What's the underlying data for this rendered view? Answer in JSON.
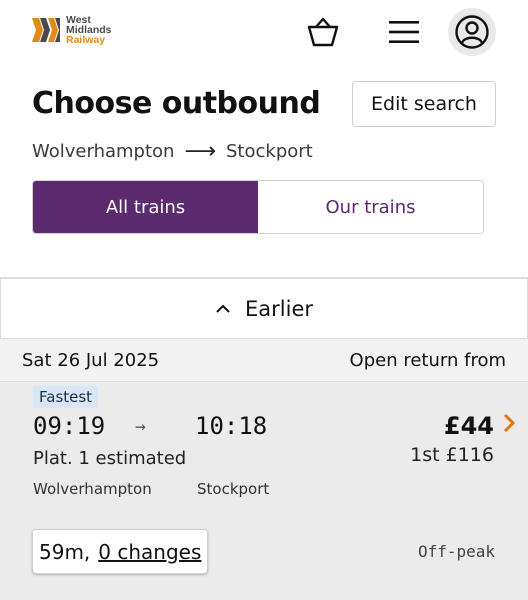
{
  "header": {
    "logo": {
      "line1": "West",
      "line2": "Midlands",
      "line3": "Railway"
    },
    "icons": {
      "basket": "basket-icon",
      "menu": "menu-icon",
      "account": "account-icon"
    }
  },
  "page": {
    "title": "Choose outbound",
    "edit_search_label": "Edit search",
    "route": {
      "from": "Wolverhampton",
      "arrow": "⟶",
      "to": "Stockport"
    }
  },
  "filter": {
    "options": [
      "All trains",
      "Our trains"
    ],
    "selected": "All trains"
  },
  "results": {
    "earlier_label": "Earlier",
    "date": "Sat 26 Jul 2025",
    "return_label": "Open return from",
    "journeys": [
      {
        "badge": "Fastest",
        "depart": "09:19",
        "arrive": "10:18",
        "price": "£44",
        "platform": "Plat. 1 estimated",
        "first_class": "1st £116",
        "from": "Wolverhampton",
        "to": "Stockport",
        "duration": "59m,",
        "changes": "0 changes",
        "ticket_type": "Off-peak"
      }
    ]
  },
  "colors": {
    "brand_purple": "#5c2a6f",
    "accent_orange": "#e07a10",
    "badge_blue": "#d9e6f5"
  }
}
